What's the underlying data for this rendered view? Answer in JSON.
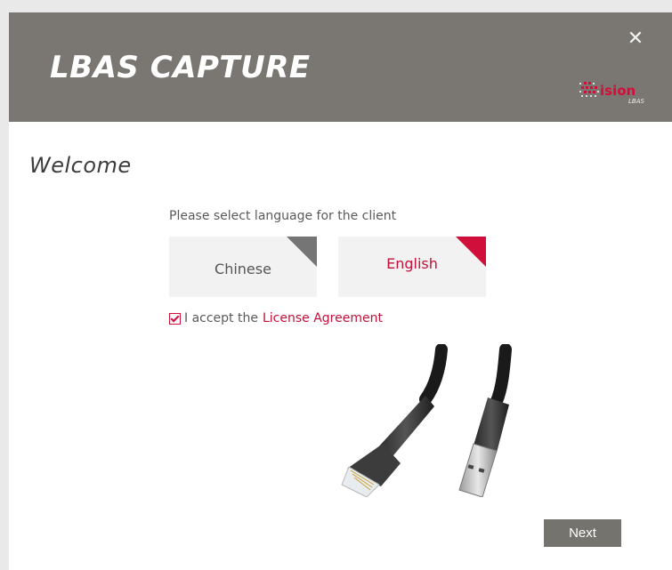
{
  "window": {
    "title": "LBAS CAPTURE",
    "close_glyph": "✕",
    "logo": {
      "text": "ision",
      "subtext": "LBAS",
      "accent_color": "#d0103a"
    }
  },
  "header": {
    "background": "#7a7772"
  },
  "main": {
    "welcome": "Welcome",
    "prompt": "Please select language for the client",
    "languages": [
      {
        "label": "Chinese",
        "selected": false
      },
      {
        "label": "English",
        "selected": true
      }
    ],
    "license": {
      "checked": true,
      "prefix": "I accept the",
      "link": "License Agreement"
    },
    "image": "network-cable-illustration",
    "next_button": "Next"
  },
  "colors": {
    "accent": "#d0103a",
    "button_gray": "#75736e",
    "tile_bg": "#f2f2f2"
  }
}
